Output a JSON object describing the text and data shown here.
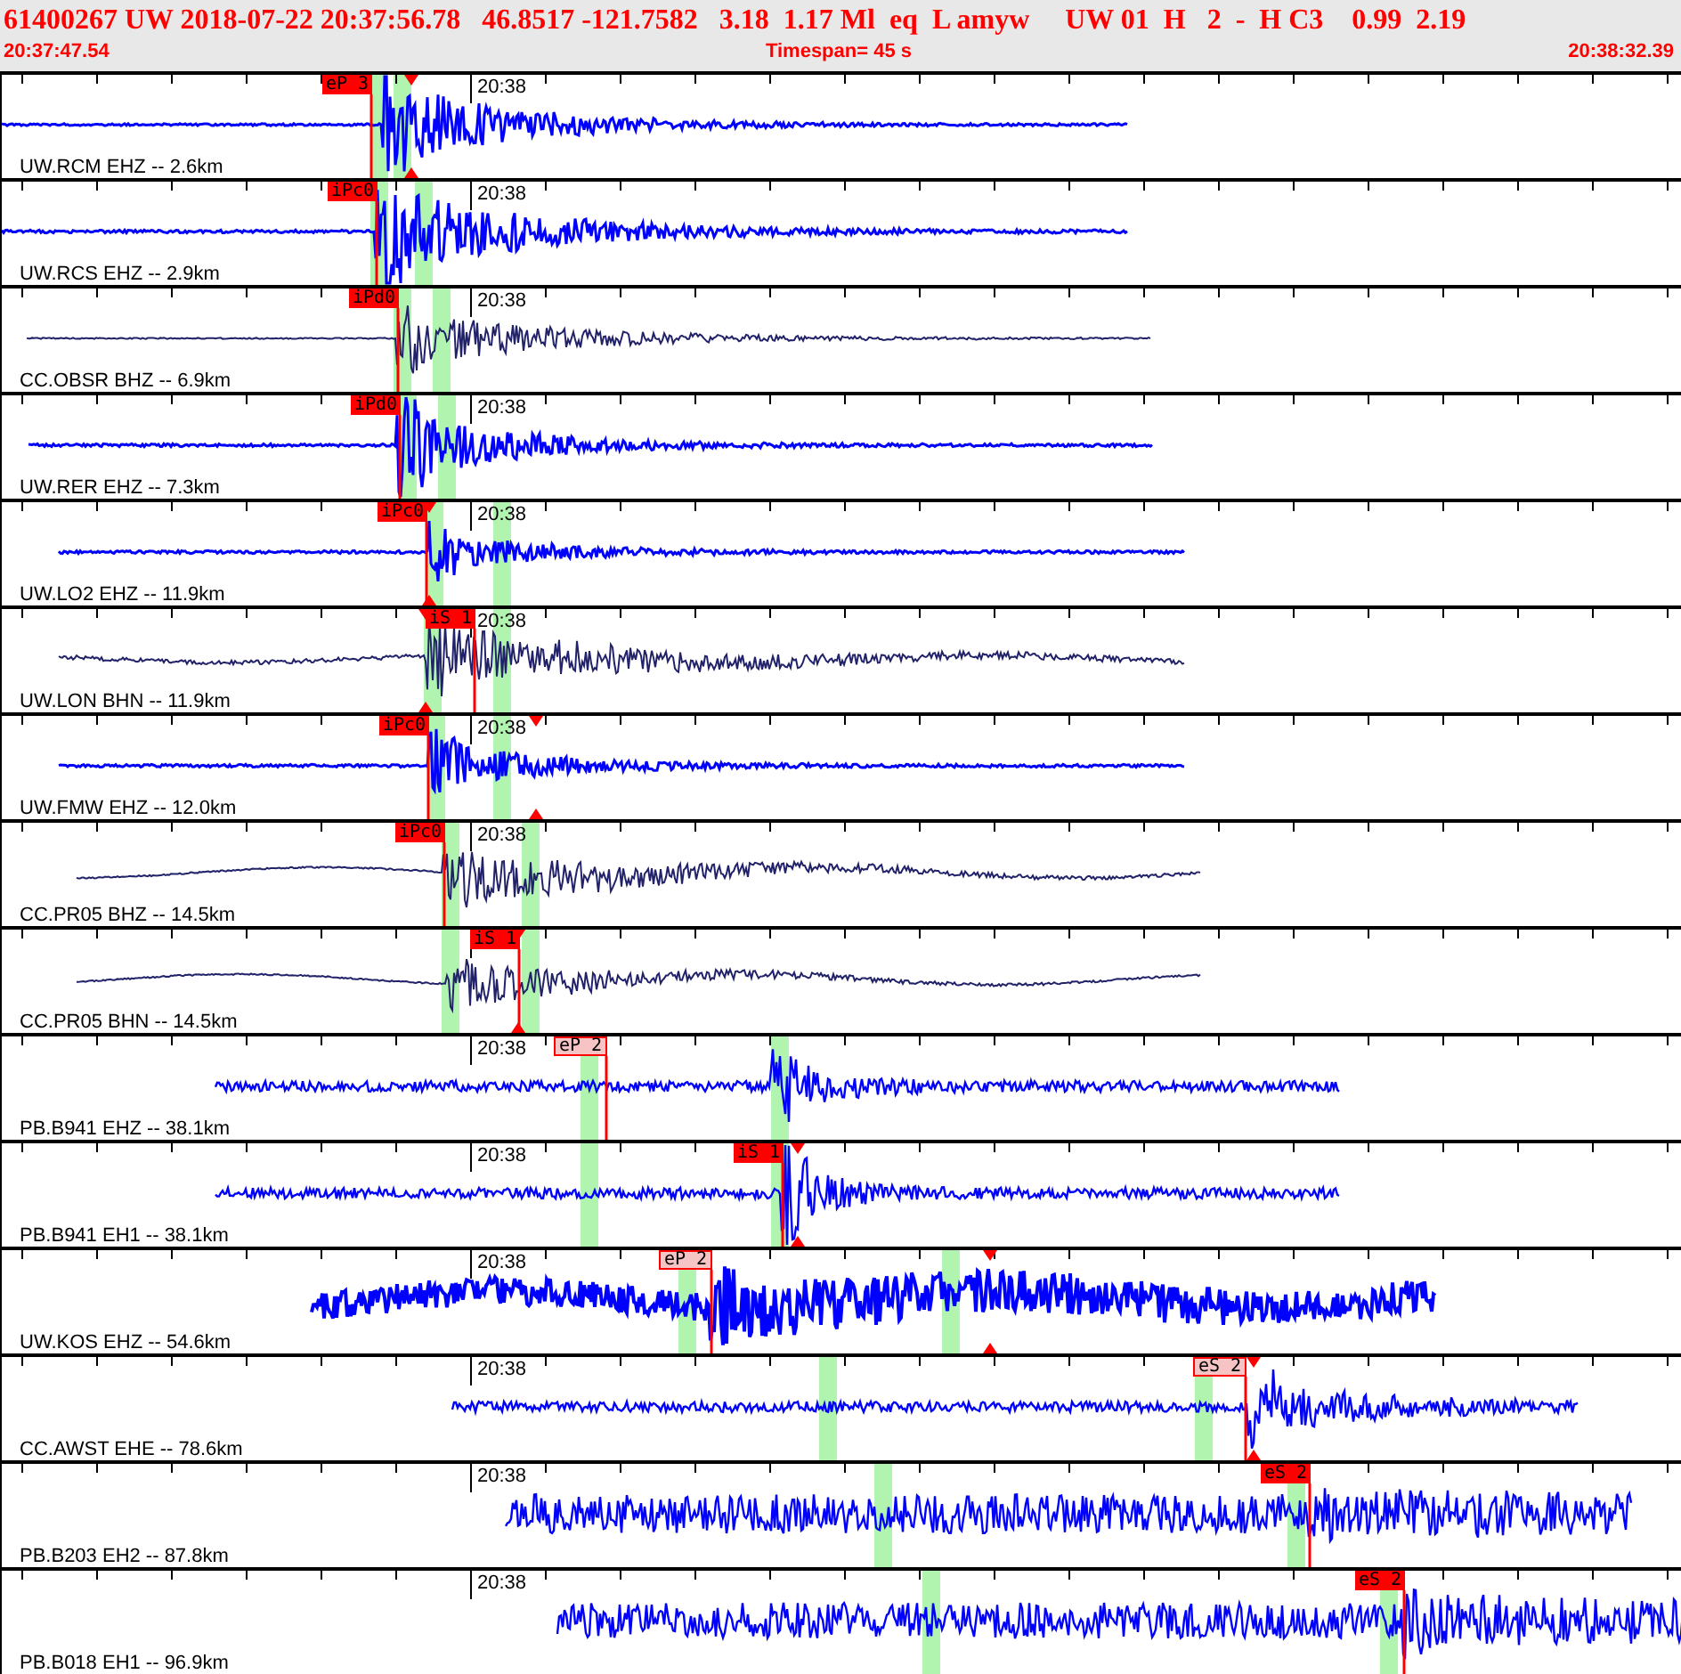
{
  "header": {
    "event_line": "61400267 UW 2018-07-22 20:37:56.78   46.8517 -121.7582   3.18  1.17 Ml  eq  L amyw     UW 01  H   2  -  H C3    0.99  2.19",
    "start_time": "20:37:47.54",
    "timespan": "Timespan=  45 s",
    "end_time": "20:38:32.39"
  },
  "traces": [
    {
      "label": "UW.RCM EHZ -- 2.6km",
      "time_mark": "20:38",
      "color": "#0000ff",
      "picks": [
        {
          "label": "eP 3",
          "kind": "final"
        }
      ]
    },
    {
      "label": "UW.RCS EHZ -- 2.9km",
      "time_mark": "20:38",
      "color": "#0000ff",
      "picks": [
        {
          "label": "iPc0",
          "kind": "final"
        }
      ]
    },
    {
      "label": "CC.OBSR BHZ -- 6.9km",
      "time_mark": "20:38",
      "color": "#22226a",
      "picks": [
        {
          "label": "iPd0",
          "kind": "final"
        }
      ]
    },
    {
      "label": "UW.RER EHZ -- 7.3km",
      "time_mark": "20:38",
      "color": "#0000ff",
      "picks": [
        {
          "label": "iPd0",
          "kind": "final"
        }
      ]
    },
    {
      "label": "UW.LO2 EHZ -- 11.9km",
      "time_mark": "20:38",
      "color": "#0000ff",
      "picks": [
        {
          "label": "iPc0",
          "kind": "final"
        }
      ]
    },
    {
      "label": "UW.LON BHN -- 11.9km",
      "time_mark": "20:38",
      "color": "#22226a",
      "picks": [
        {
          "label": "iS 1",
          "kind": "final"
        }
      ]
    },
    {
      "label": "UW.FMW EHZ -- 12.0km",
      "time_mark": "20:38",
      "color": "#0000ff",
      "picks": [
        {
          "label": "iPc0",
          "kind": "final"
        }
      ]
    },
    {
      "label": "CC.PR05 BHZ -- 14.5km",
      "time_mark": "20:38",
      "color": "#22226a",
      "picks": [
        {
          "label": "iPc0",
          "kind": "final"
        }
      ]
    },
    {
      "label": "CC.PR05 BHN -- 14.5km",
      "color": "#22226a",
      "picks": [
        {
          "label": "iS 1",
          "kind": "final"
        }
      ]
    },
    {
      "label": "PB.B941 EHZ -- 38.1km",
      "time_mark": "20:38",
      "color": "#0000ff",
      "picks": [
        {
          "label": "eP 2",
          "kind": "tentative"
        }
      ]
    },
    {
      "label": "PB.B941 EH1 -- 38.1km",
      "time_mark": "20:38",
      "color": "#0000ff",
      "picks": [
        {
          "label": "iS 1",
          "kind": "final"
        }
      ]
    },
    {
      "label": "UW.KOS EHZ -- 54.6km",
      "time_mark": "20:38",
      "color": "#0000ff",
      "picks": [
        {
          "label": "eP 2",
          "kind": "tentative"
        }
      ]
    },
    {
      "label": "CC.AWST EHE -- 78.6km",
      "time_mark": "20:38",
      "color": "#0000ff",
      "picks": [
        {
          "label": "eS 2",
          "kind": "tentative"
        }
      ]
    },
    {
      "label": "PB.B203 EH2 -- 87.8km",
      "time_mark": "20:38",
      "color": "#0000ff",
      "picks": [
        {
          "label": "eS 2",
          "kind": "final"
        }
      ]
    },
    {
      "label": "PB.B018 EH1 -- 96.9km",
      "time_mark": "20:38",
      "color": "#0000ff",
      "picks": [
        {
          "label": "eS 2",
          "kind": "final"
        }
      ]
    }
  ]
}
